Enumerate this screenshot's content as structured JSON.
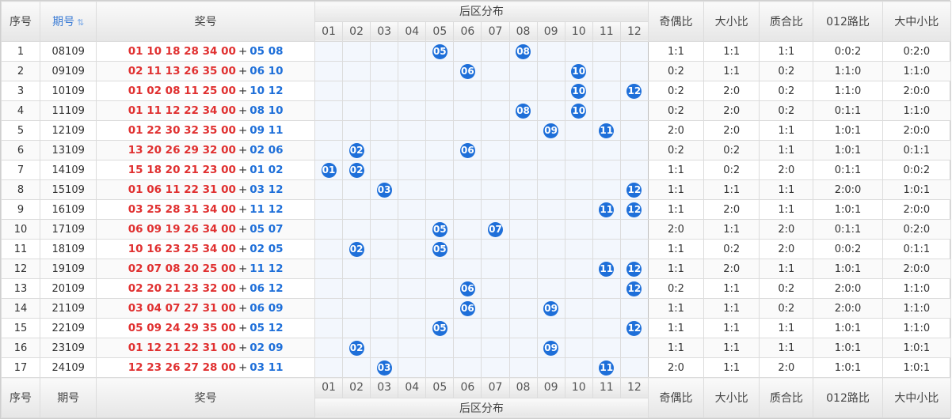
{
  "headers": {
    "seq": "序号",
    "issue": "期号",
    "prize": "奖号",
    "distribution": "后区分布",
    "ratios": [
      "奇偶比",
      "大小比",
      "质合比",
      "012路比",
      "大中小比"
    ]
  },
  "dist_numbers": [
    "01",
    "02",
    "03",
    "04",
    "05",
    "06",
    "07",
    "08",
    "09",
    "10",
    "11",
    "12"
  ],
  "rows": [
    {
      "seq": "1",
      "issue": "08109",
      "front": "01 10 18 28 34 00",
      "back": "05 08",
      "balls": [
        "05",
        "08"
      ],
      "ratios": [
        "1:1",
        "1:1",
        "1:1",
        "0:0:2",
        "0:2:0"
      ]
    },
    {
      "seq": "2",
      "issue": "09109",
      "front": "02 11 13 26 35 00",
      "back": "06 10",
      "balls": [
        "06",
        "10"
      ],
      "ratios": [
        "0:2",
        "1:1",
        "0:2",
        "1:1:0",
        "1:1:0"
      ]
    },
    {
      "seq": "3",
      "issue": "10109",
      "front": "01 02 08 11 25 00",
      "back": "10 12",
      "balls": [
        "10",
        "12"
      ],
      "ratios": [
        "0:2",
        "2:0",
        "0:2",
        "1:1:0",
        "2:0:0"
      ]
    },
    {
      "seq": "4",
      "issue": "11109",
      "front": "01 11 12 22 34 00",
      "back": "08 10",
      "balls": [
        "08",
        "10"
      ],
      "ratios": [
        "0:2",
        "2:0",
        "0:2",
        "0:1:1",
        "1:1:0"
      ]
    },
    {
      "seq": "5",
      "issue": "12109",
      "front": "01 22 30 32 35 00",
      "back": "09 11",
      "balls": [
        "09",
        "11"
      ],
      "ratios": [
        "2:0",
        "2:0",
        "1:1",
        "1:0:1",
        "2:0:0"
      ]
    },
    {
      "seq": "6",
      "issue": "13109",
      "front": "13 20 26 29 32 00",
      "back": "02 06",
      "balls": [
        "02",
        "06"
      ],
      "ratios": [
        "0:2",
        "0:2",
        "1:1",
        "1:0:1",
        "0:1:1"
      ]
    },
    {
      "seq": "7",
      "issue": "14109",
      "front": "15 18 20 21 23 00",
      "back": "01 02",
      "balls": [
        "01",
        "02"
      ],
      "ratios": [
        "1:1",
        "0:2",
        "2:0",
        "0:1:1",
        "0:0:2"
      ]
    },
    {
      "seq": "8",
      "issue": "15109",
      "front": "01 06 11 22 31 00",
      "back": "03 12",
      "balls": [
        "03",
        "12"
      ],
      "ratios": [
        "1:1",
        "1:1",
        "1:1",
        "2:0:0",
        "1:0:1"
      ]
    },
    {
      "seq": "9",
      "issue": "16109",
      "front": "03 25 28 31 34 00",
      "back": "11 12",
      "balls": [
        "11",
        "12"
      ],
      "ratios": [
        "1:1",
        "2:0",
        "1:1",
        "1:0:1",
        "2:0:0"
      ]
    },
    {
      "seq": "10",
      "issue": "17109",
      "front": "06 09 19 26 34 00",
      "back": "05 07",
      "balls": [
        "05",
        "07"
      ],
      "ratios": [
        "2:0",
        "1:1",
        "2:0",
        "0:1:1",
        "0:2:0"
      ]
    },
    {
      "seq": "11",
      "issue": "18109",
      "front": "10 16 23 25 34 00",
      "back": "02 05",
      "balls": [
        "02",
        "05"
      ],
      "ratios": [
        "1:1",
        "0:2",
        "2:0",
        "0:0:2",
        "0:1:1"
      ]
    },
    {
      "seq": "12",
      "issue": "19109",
      "front": "02 07 08 20 25 00",
      "back": "11 12",
      "balls": [
        "11",
        "12"
      ],
      "ratios": [
        "1:1",
        "2:0",
        "1:1",
        "1:0:1",
        "2:0:0"
      ]
    },
    {
      "seq": "13",
      "issue": "20109",
      "front": "02 20 21 23 32 00",
      "back": "06 12",
      "balls": [
        "06",
        "12"
      ],
      "ratios": [
        "0:2",
        "1:1",
        "0:2",
        "2:0:0",
        "1:1:0"
      ]
    },
    {
      "seq": "14",
      "issue": "21109",
      "front": "03 04 07 27 31 00",
      "back": "06 09",
      "balls": [
        "06",
        "09"
      ],
      "ratios": [
        "1:1",
        "1:1",
        "0:2",
        "2:0:0",
        "1:1:0"
      ]
    },
    {
      "seq": "15",
      "issue": "22109",
      "front": "05 09 24 29 35 00",
      "back": "05 12",
      "balls": [
        "05",
        "12"
      ],
      "ratios": [
        "1:1",
        "1:1",
        "1:1",
        "1:0:1",
        "1:1:0"
      ]
    },
    {
      "seq": "16",
      "issue": "23109",
      "front": "01 12 21 22 31 00",
      "back": "02 09",
      "balls": [
        "02",
        "09"
      ],
      "ratios": [
        "1:1",
        "1:1",
        "1:1",
        "1:0:1",
        "1:0:1"
      ]
    },
    {
      "seq": "17",
      "issue": "24109",
      "front": "12 23 26 27 28 00",
      "back": "03 11",
      "balls": [
        "03",
        "11"
      ],
      "ratios": [
        "2:0",
        "1:1",
        "2:0",
        "1:0:1",
        "1:0:1"
      ]
    }
  ],
  "colors": {
    "front": "#e03030",
    "back": "#1e6fd9",
    "ball": "#1e6fd9",
    "sortable": "#3a7bd5"
  },
  "icons": {
    "sort": "sort-icon"
  }
}
